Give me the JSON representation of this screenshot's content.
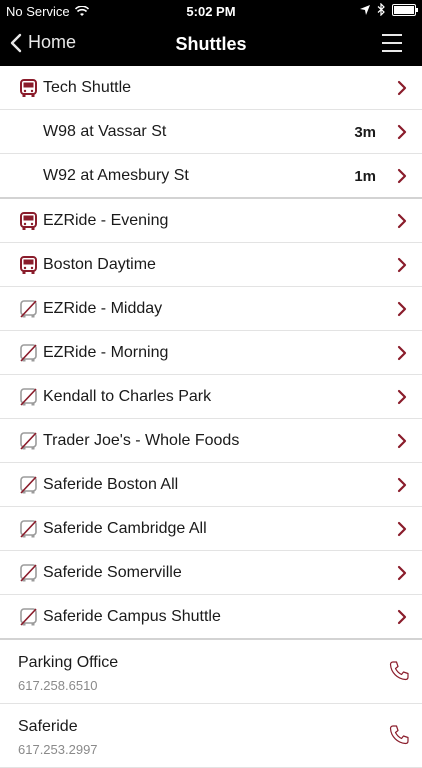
{
  "status_bar": {
    "carrier": "No Service",
    "time": "5:02 PM",
    "icons": [
      "wifi-icon",
      "location-arrow-icon",
      "bluetooth-icon",
      "battery-icon"
    ]
  },
  "nav": {
    "back_label": "Home",
    "title": "Shuttles",
    "menu_icon": "hamburger-menu-icon"
  },
  "colors": {
    "accent": "#8a1c2b",
    "inactive_icon": "#9b9b9b",
    "bar": "#000000"
  },
  "routes": [
    {
      "label": "Tech Shuttle",
      "active": true,
      "stops": [
        {
          "label": "W98 at Vassar St",
          "eta": "3m"
        },
        {
          "label": "W92 at Amesbury St",
          "eta": "1m"
        }
      ]
    },
    {
      "label": "EZRide - Evening",
      "active": true
    },
    {
      "label": "Boston Daytime",
      "active": true
    },
    {
      "label": "EZRide - Midday",
      "active": false
    },
    {
      "label": "EZRide - Morning",
      "active": false
    },
    {
      "label": "Kendall to Charles Park",
      "active": false
    },
    {
      "label": "Trader Joe's - Whole Foods",
      "active": false
    },
    {
      "label": "Saferide Boston All",
      "active": false
    },
    {
      "label": "Saferide Cambridge All",
      "active": false
    },
    {
      "label": "Saferide Somerville",
      "active": false
    },
    {
      "label": "Saferide Campus Shuttle",
      "active": false
    }
  ],
  "contacts": [
    {
      "name": "Parking Office",
      "phone": "617.258.6510"
    },
    {
      "name": "Saferide",
      "phone": "617.253.2997"
    }
  ]
}
